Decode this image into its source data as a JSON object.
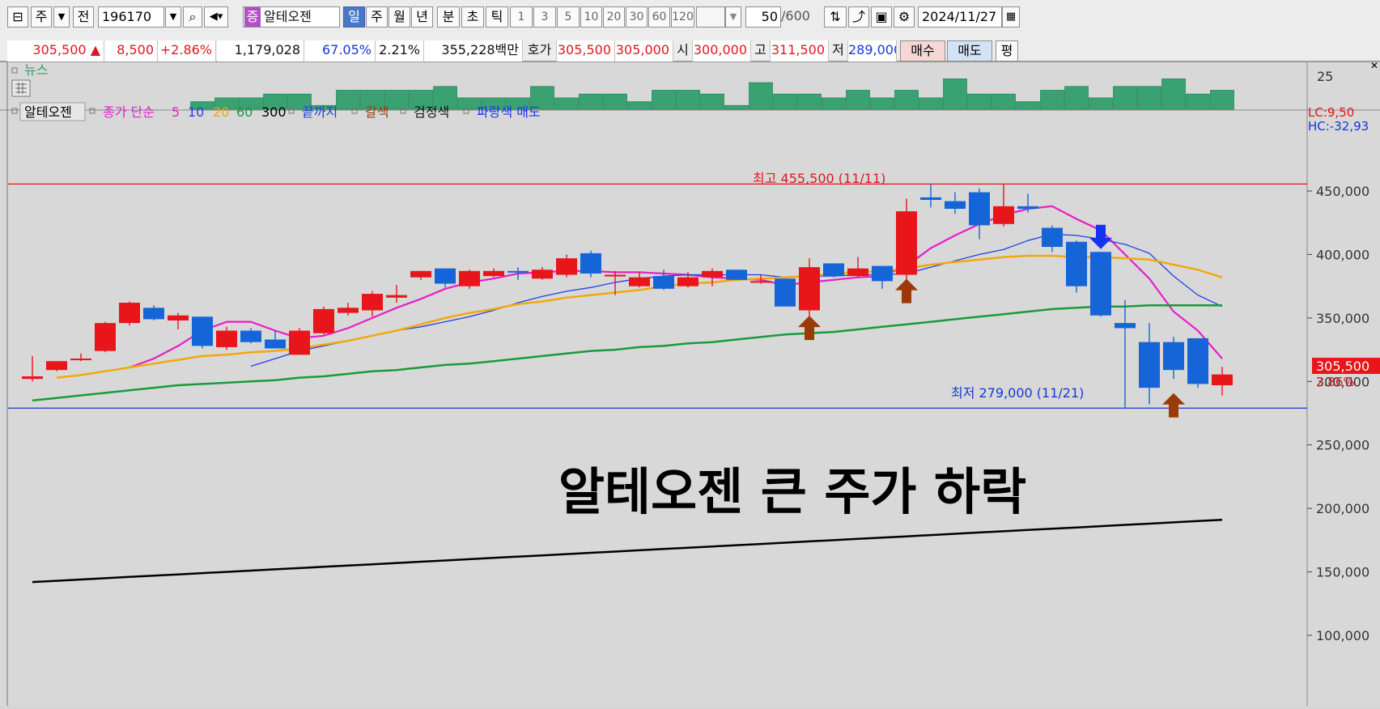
{
  "toolbar": {
    "period_week": "주",
    "prev_label": "전",
    "stock_code": "196170",
    "stock_badge": "증",
    "stock_name": "알테오젠",
    "periods": [
      "일",
      "주",
      "월",
      "년"
    ],
    "intervals": [
      "분",
      "초",
      "틱"
    ],
    "minute_options": [
      "1",
      "3",
      "5",
      "10",
      "20",
      "30",
      "60",
      "120"
    ],
    "count_value": "50",
    "count_total": "/600",
    "date": "2024/11/27"
  },
  "quote": {
    "price": "305,500",
    "change_icon": "up-triangle-icon",
    "change": "8,500",
    "change_pct": "+2.86%",
    "volume": "1,179,028",
    "ratio1": "67.05%",
    "ratio2": "2.21%",
    "amount": "355,228백만",
    "hoga_label": "호가",
    "ask": "305,500",
    "bid": "305,000",
    "open_label": "시",
    "open": "300,000",
    "high_label": "고",
    "high": "311,500",
    "low_label": "저",
    "low": "289,000",
    "buy_label": "매수",
    "sell_label": "매도",
    "eval_label": "평"
  },
  "news": {
    "label": "뉴스",
    "axis_label": "25"
  },
  "legend": {
    "stock": "알테오젠",
    "ma_label": "종가 단순",
    "periods": [
      "5",
      "10",
      "20",
      "60",
      "300"
    ],
    "item1": "끝까지",
    "item2": "갈색",
    "item3": "검정색",
    "item4": "파랑색 매도"
  },
  "side_labels": {
    "lc": "LC:9,50",
    "hc": "HC:-32,93"
  },
  "annotations": {
    "high": "최고 455,500 (11/11)",
    "low": "최저 279,000 (11/21)",
    "headline": "알테오젠 큰 주가 하락"
  },
  "price_tag": {
    "price": "305,500",
    "pct": "2.86%"
  },
  "colors": {
    "up": "#e8151b",
    "down": "#1565d8",
    "ma5": "#e81ec8",
    "ma10": "#2140e6",
    "ma20": "#f2a80d",
    "ma60": "#1a9a3a",
    "ma300": "#000000",
    "arrow_brown": "#9a3a06",
    "arrow_blue": "#1733f0"
  },
  "chart_data": {
    "type": "candlestick",
    "ylim": [
      90000,
      470000
    ],
    "y_ticks": [
      "450,000",
      "400,000",
      "350,000",
      "300,000",
      "250,000",
      "200,000",
      "150,000",
      "100,000"
    ],
    "y_tick_values": [
      450000,
      400000,
      350000,
      300000,
      250000,
      200000,
      150000,
      100000
    ],
    "high_line": 455500,
    "low_line": 279000,
    "candles": [
      {
        "o": 302000,
        "h": 320000,
        "l": 300000,
        "c": 304000
      },
      {
        "o": 309000,
        "h": 316000,
        "l": 308000,
        "c": 316000
      },
      {
        "o": 318000,
        "h": 322000,
        "l": 316000,
        "c": 318000
      },
      {
        "o": 324000,
        "h": 347000,
        "l": 323000,
        "c": 346000
      },
      {
        "o": 346000,
        "h": 363000,
        "l": 344000,
        "c": 362000
      },
      {
        "o": 358000,
        "h": 360000,
        "l": 348000,
        "c": 349000
      },
      {
        "o": 348000,
        "h": 354000,
        "l": 341000,
        "c": 352000
      },
      {
        "o": 351000,
        "h": 351000,
        "l": 326000,
        "c": 328000
      },
      {
        "o": 327000,
        "h": 343000,
        "l": 325000,
        "c": 340000
      },
      {
        "o": 340000,
        "h": 342000,
        "l": 330000,
        "c": 331000
      },
      {
        "o": 333000,
        "h": 340000,
        "l": 326000,
        "c": 326000
      },
      {
        "o": 321000,
        "h": 342000,
        "l": 321000,
        "c": 340000
      },
      {
        "o": 338000,
        "h": 359000,
        "l": 337000,
        "c": 357000
      },
      {
        "o": 354000,
        "h": 362000,
        "l": 352000,
        "c": 358000
      },
      {
        "o": 356000,
        "h": 371000,
        "l": 351000,
        "c": 369000
      },
      {
        "o": 366000,
        "h": 376000,
        "l": 362000,
        "c": 368000
      },
      {
        "o": 382000,
        "h": 387000,
        "l": 380000,
        "c": 387000
      },
      {
        "o": 389000,
        "h": 389000,
        "l": 374000,
        "c": 377000
      },
      {
        "o": 375000,
        "h": 388000,
        "l": 373000,
        "c": 387000
      },
      {
        "o": 383000,
        "h": 389000,
        "l": 382000,
        "c": 387000
      },
      {
        "o": 387000,
        "h": 390000,
        "l": 380000,
        "c": 386000
      },
      {
        "o": 381000,
        "h": 390000,
        "l": 380000,
        "c": 388000
      },
      {
        "o": 384000,
        "h": 400000,
        "l": 382000,
        "c": 397000
      },
      {
        "o": 401000,
        "h": 403000,
        "l": 382000,
        "c": 385000
      },
      {
        "o": 384000,
        "h": 387000,
        "l": 368000,
        "c": 384000
      },
      {
        "o": 375000,
        "h": 386000,
        "l": 374000,
        "c": 382000
      },
      {
        "o": 383000,
        "h": 388000,
        "l": 372000,
        "c": 373000
      },
      {
        "o": 375000,
        "h": 386000,
        "l": 374000,
        "c": 382000
      },
      {
        "o": 382000,
        "h": 389000,
        "l": 375000,
        "c": 387000
      },
      {
        "o": 388000,
        "h": 388000,
        "l": 380000,
        "c": 380000
      },
      {
        "o": 379000,
        "h": 384000,
        "l": 377000,
        "c": 379000
      },
      {
        "o": 381000,
        "h": 381000,
        "l": 361000,
        "c": 359000
      },
      {
        "o": 356000,
        "h": 397000,
        "l": 349000,
        "c": 390000
      },
      {
        "o": 393000,
        "h": 393000,
        "l": 382000,
        "c": 383000
      },
      {
        "o": 383000,
        "h": 398000,
        "l": 382000,
        "c": 389000
      },
      {
        "o": 391000,
        "h": 391000,
        "l": 373000,
        "c": 379000
      },
      {
        "o": 384000,
        "h": 444000,
        "l": 380000,
        "c": 434000
      },
      {
        "o": 445000,
        "h": 455500,
        "l": 437000,
        "c": 443000
      },
      {
        "o": 442000,
        "h": 449000,
        "l": 432000,
        "c": 436000
      },
      {
        "o": 449000,
        "h": 452000,
        "l": 412000,
        "c": 423000
      },
      {
        "o": 424000,
        "h": 455000,
        "l": 422000,
        "c": 438000
      },
      {
        "o": 438000,
        "h": 448000,
        "l": 433000,
        "c": 436000
      },
      {
        "o": 421000,
        "h": 423000,
        "l": 402000,
        "c": 406000
      },
      {
        "o": 410000,
        "h": 411000,
        "l": 370000,
        "c": 375000
      },
      {
        "o": 402000,
        "h": 402000,
        "l": 351000,
        "c": 352000
      },
      {
        "o": 346000,
        "h": 364000,
        "l": 279000,
        "c": 342000
      },
      {
        "o": 331000,
        "h": 346000,
        "l": 282000,
        "c": 295000
      },
      {
        "o": 331000,
        "h": 335000,
        "l": 302000,
        "c": 309000
      },
      {
        "o": 334000,
        "h": 334000,
        "l": 295000,
        "c": 298000
      },
      {
        "o": 297000,
        "h": 311500,
        "l": 289000,
        "c": 305500
      }
    ],
    "series": [
      {
        "name": "5",
        "values": [
          null,
          null,
          null,
          null,
          311000,
          318000,
          328000,
          340000,
          347000,
          347000,
          340000,
          334000,
          336000,
          342000,
          350000,
          358000,
          365000,
          373000,
          378000,
          381000,
          385000,
          386000,
          387000,
          387000,
          386000,
          386000,
          385000,
          384000,
          382000,
          381000,
          380000,
          376000,
          378000,
          380000,
          382000,
          383000,
          391000,
          405000,
          415000,
          424000,
          431000,
          436000,
          438000,
          428000,
          419000,
          400000,
          381000,
          355000,
          340000,
          318000
        ]
      },
      {
        "name": "10",
        "values": [
          null,
          null,
          null,
          null,
          null,
          null,
          null,
          null,
          null,
          312000,
          318000,
          324000,
          328000,
          332000,
          336000,
          340000,
          343000,
          347000,
          351000,
          356000,
          362000,
          367000,
          371000,
          374000,
          378000,
          381000,
          383000,
          384000,
          384000,
          384000,
          384000,
          382000,
          383000,
          383000,
          384000,
          384000,
          385000,
          390000,
          395000,
          400000,
          404000,
          411000,
          416000,
          415000,
          412000,
          408000,
          401000,
          383000,
          368000,
          359000
        ]
      },
      {
        "name": "20",
        "values": [
          null,
          303000,
          305000,
          308000,
          311000,
          314000,
          317000,
          320000,
          321000,
          323000,
          324000,
          326000,
          329000,
          332000,
          336000,
          340000,
          345000,
          350000,
          354000,
          357000,
          361000,
          363000,
          366000,
          368000,
          370000,
          372000,
          375000,
          377000,
          378000,
          380000,
          381000,
          382000,
          383000,
          385000,
          386000,
          387000,
          389000,
          392000,
          394000,
          396000,
          398000,
          399000,
          399000,
          398000,
          398000,
          397000,
          396000,
          392000,
          388000,
          382000
        ]
      },
      {
        "name": "60",
        "values": [
          285000,
          287000,
          289000,
          291000,
          293000,
          295000,
          297000,
          298000,
          299000,
          300000,
          301000,
          303000,
          304000,
          306000,
          308000,
          309000,
          311000,
          313000,
          314000,
          316000,
          318000,
          320000,
          322000,
          324000,
          325000,
          327000,
          328000,
          330000,
          331000,
          333000,
          335000,
          337000,
          338000,
          339000,
          341000,
          343000,
          345000,
          347000,
          349000,
          351000,
          353000,
          355000,
          357000,
          358000,
          359000,
          359000,
          360000,
          360000,
          360000,
          360000
        ]
      },
      {
        "name": "300",
        "values": [
          142000,
          143000,
          144000,
          145000,
          146000,
          147000,
          148000,
          149000,
          150000,
          151000,
          152000,
          153000,
          154000,
          155000,
          156000,
          157000,
          158000,
          159000,
          160000,
          161000,
          162000,
          163000,
          164000,
          165000,
          166000,
          167000,
          168000,
          169000,
          170000,
          171000,
          172000,
          173000,
          174000,
          175000,
          176000,
          177000,
          178000,
          179000,
          180000,
          181000,
          182000,
          183000,
          184000,
          185000,
          186000,
          187000,
          188000,
          189000,
          190000,
          191000
        ]
      }
    ],
    "news_counts": [
      0,
      0,
      0,
      0,
      0,
      0,
      0,
      2,
      3,
      3,
      4,
      4,
      1,
      5,
      5,
      5,
      5,
      6,
      3,
      3,
      3,
      6,
      3,
      4,
      4,
      2,
      5,
      5,
      4,
      1,
      7,
      4,
      4,
      3,
      5,
      3,
      5,
      3,
      8,
      4,
      4,
      2,
      5,
      6,
      3,
      6,
      6,
      8,
      4,
      5
    ],
    "markers": [
      {
        "type": "buy",
        "index": 32,
        "price": 339000
      },
      {
        "type": "buy",
        "index": 36,
        "price": 368000
      },
      {
        "type": "sell",
        "index": 44,
        "price": 417000
      },
      {
        "type": "buy",
        "index": 47,
        "price": 278000
      }
    ]
  }
}
